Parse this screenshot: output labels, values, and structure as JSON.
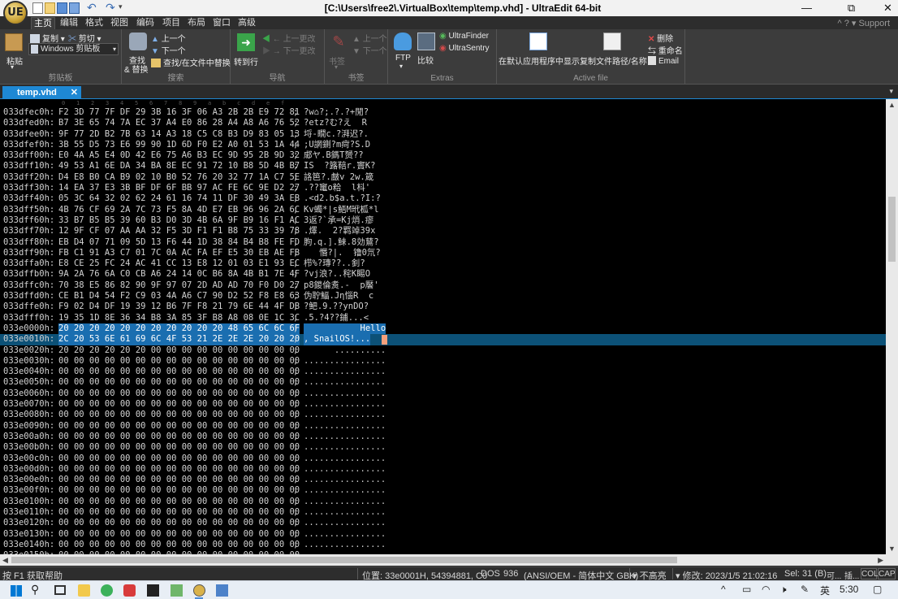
{
  "window": {
    "title": "[C:\\Users\\free2\\.VirtualBox\\temp\\temp.vhd] - UltraEdit 64-bit",
    "logo_text": "UE",
    "controls": [
      "—",
      "⧉",
      "✕"
    ]
  },
  "menu": {
    "tabs": [
      "主页",
      "编辑",
      "格式",
      "视图",
      "编码",
      "项目",
      "布局",
      "窗口",
      "高级"
    ],
    "active": "主页",
    "support": "Support"
  },
  "ribbon": {
    "clipboard": {
      "paste": "粘贴",
      "copy": "复制",
      "cut": "剪切",
      "clipboard_select": "Windows 剪贴板",
      "label": "剪贴板"
    },
    "search": {
      "find_replace_1": "查找",
      "find_replace_2": "& 替换",
      "prev": "上一个",
      "next": "下一个",
      "find_in_files": "查找/在文件中替换",
      "label": "搜索"
    },
    "navigation": {
      "goto": "转到行",
      "prev_change": "上一更改",
      "next_change": "下一更改",
      "label": "导航"
    },
    "bookmarks": {
      "bookmark": "书签",
      "prev": "上一个",
      "next": "下一个",
      "label": "书签"
    },
    "extras": {
      "ftp": "FTP",
      "compare": "比较",
      "ultrafinder": "UltraFinder",
      "ultrasentry": "UltraSentry",
      "label": "Extras"
    },
    "active_file": {
      "show_in_app": "在默认应用程序中显示",
      "copy_path": "复制文件路径/名称",
      "delete": "删除",
      "rename": "重命名",
      "email": "Email",
      "label": "Active file"
    }
  },
  "document": {
    "tab_label": "temp.vhd"
  },
  "ruler": [
    "0",
    "1",
    "2",
    "3",
    "4",
    "5",
    "6",
    "7",
    "8",
    "9",
    "a",
    "b",
    "c",
    "d",
    "e",
    "f"
  ],
  "hex_rows": [
    {
      "addr": "033dfec0h:",
      "hex": "F2 3D 77 7F DF 29 3B 16 3F 06 A3 2B 2B E9 72 81",
      "ascii": "?w⌂?;.?.?+閒?"
    },
    {
      "addr": "033dfed0h:",
      "hex": "B7 3E 65 74 7A EC 37 A4 E0 86 28 A4 A8 A6 76 52",
      "ascii": "?etz?む?え  R"
    },
    {
      "addr": "033dfee0h:",
      "hex": "9F 77 2D B2 7B 63 14 A3 18 C5 C8 B3 D9 83 05 13",
      "ascii": "埒-瞯c.?湃迟?."
    },
    {
      "addr": "033dfef0h:",
      "hex": "3B 55 D5 73 E6 99 90 1D 6D F0 E2 A0 01 53 1A 44",
      "ascii": ";U誷鍘?m疴?S.D"
    },
    {
      "addr": "033dff00h:",
      "hex": "E0 4A A5 E4 0D 42 E6 75 A6 B3 EC 9D 95 2B 9D 32",
      "ascii": "郕ヤ.B鎷T赟??"
    },
    {
      "addr": "033dff10h:",
      "hex": "49 53 A1 6E DA 34 BA 8E EC 91 72 10 B8 5D 4B B7",
      "ascii": "IS  ?簬鞛r.竇K?"
    },
    {
      "addr": "033dff20h:",
      "hex": "D4 E8 B0 CA B9 02 10 B0 52 76 20 32 77 1A C7 5E",
      "ascii": "詻笆?.皻v 2w.箴"
    },
    {
      "addr": "033dff30h:",
      "hex": "14 EA 37 E3 3B BF DF 6F BB 97 AC FE 6C 9E D2 27",
      "ascii": ".??竃o粭  l枓'"
    },
    {
      "addr": "033dff40h:",
      "hex": "05 3C 64 32 02 62 24 61 16 74 11 DF 30 49 3A EB",
      "ascii": ".<d2.b$a.t.?I:?"
    },
    {
      "addr": "033dff50h:",
      "hex": "4B 76 CF 69 2A 7C 73 F5 8A 4D E7 EB 96 96 2A 6C",
      "ascii": "Kv蠋*|s鯃M玳柧*l"
    },
    {
      "addr": "033dff60h:",
      "hex": "33 B7 B5 B5 39 60 B3 D0 3D 4B 6A 9F B9 16 F1 AC",
      "ascii": "3返?`承=Kj焇.瘳"
    },
    {
      "addr": "033dff70h:",
      "hex": "12 9F CF 07 AA AA 32 F5 3D F1 F1 B8 75 33 39 78",
      "ascii": ".燡.  2?羁竨39x"
    },
    {
      "addr": "033dff80h:",
      "hex": "EB D4 07 71 09 5D 13 F6 44 1D 38 84 B4 B8 FE FD",
      "ascii": "朐.q.].鯠.8効鶿?"
    },
    {
      "addr": "033dff90h:",
      "hex": "FB C1 91 A3 C7 01 7C 0A AC FA EF E5 30 EB AE FB",
      "ascii": "   惽?|.  镥0氘?"
    },
    {
      "addr": "033dffa0h:",
      "hex": "E8 CE 25 FC 24 AC 41 CC 13 E8 12 01 03 E1 93 EC",
      "ascii": "栉%?瑼??..釗?"
    },
    {
      "addr": "033dffb0h:",
      "hex": "9A 2A 76 6A C0 CB A6 24 14 0C B6 8A 4B B1 7E 4F",
      "ascii": "?vj浪?..秺K睗O"
    },
    {
      "addr": "033dffc0h:",
      "hex": "70 38 E5 86 82 90 9F 97 07 2D AD AD 70 F0 D0 27",
      "ascii": "p8鍐倫煑.-  p饜'"
    },
    {
      "addr": "033dffd0h:",
      "hex": "CE B1 D4 54 F2 C9 03 4A A6 C7 90 D2 52 F8 E8 63",
      "ascii": "伪聍鰏.Jη惱R  c"
    },
    {
      "addr": "033dffe0h:",
      "hex": "F9 02 D4 DF 19 39 12 B6 7F F8 21 79 6E 44 4F DB",
      "ascii": "?鲃.9.??ynDO?"
    },
    {
      "addr": "033dfff0h:",
      "hex": "19 35 1D 8E 36 34 B8 3A 85 3F B8 A8 08 0E 1C 3C",
      "ascii": ".5.?4??鋪...<"
    },
    {
      "addr": "033e0000h:",
      "hex": "20 20 20 20 20 20 20 20 20 20 20 48 65 6C 6C 6F",
      "ascii": "           Hello",
      "selected": true
    },
    {
      "addr": "033e0010h:",
      "hex": "2C 20 53 6E 61 69 6C 4F 53 21 2E 2E 2E 20 20 20",
      "ascii": ", SnailOS!...",
      "selected": true,
      "current": true
    },
    {
      "addr": "033e0020h:",
      "hex": "20 20 20 20 20 20 00 00 00 00 00 00 00 00 00 00",
      "ascii": "      .........."
    },
    {
      "addr": "033e0030h:",
      "hex": "00 00 00 00 00 00 00 00 00 00 00 00 00 00 00 00",
      "ascii": "................"
    },
    {
      "addr": "033e0040h:",
      "hex": "00 00 00 00 00 00 00 00 00 00 00 00 00 00 00 00",
      "ascii": "................"
    },
    {
      "addr": "033e0050h:",
      "hex": "00 00 00 00 00 00 00 00 00 00 00 00 00 00 00 00",
      "ascii": "................"
    },
    {
      "addr": "033e0060h:",
      "hex": "00 00 00 00 00 00 00 00 00 00 00 00 00 00 00 00",
      "ascii": "................"
    },
    {
      "addr": "033e0070h:",
      "hex": "00 00 00 00 00 00 00 00 00 00 00 00 00 00 00 00",
      "ascii": "................"
    },
    {
      "addr": "033e0080h:",
      "hex": "00 00 00 00 00 00 00 00 00 00 00 00 00 00 00 00",
      "ascii": "................"
    },
    {
      "addr": "033e0090h:",
      "hex": "00 00 00 00 00 00 00 00 00 00 00 00 00 00 00 00",
      "ascii": "................"
    },
    {
      "addr": "033e00a0h:",
      "hex": "00 00 00 00 00 00 00 00 00 00 00 00 00 00 00 00",
      "ascii": "................"
    },
    {
      "addr": "033e00b0h:",
      "hex": "00 00 00 00 00 00 00 00 00 00 00 00 00 00 00 00",
      "ascii": "................"
    },
    {
      "addr": "033e00c0h:",
      "hex": "00 00 00 00 00 00 00 00 00 00 00 00 00 00 00 00",
      "ascii": "................"
    },
    {
      "addr": "033e00d0h:",
      "hex": "00 00 00 00 00 00 00 00 00 00 00 00 00 00 00 00",
      "ascii": "................"
    },
    {
      "addr": "033e00e0h:",
      "hex": "00 00 00 00 00 00 00 00 00 00 00 00 00 00 00 00",
      "ascii": "................"
    },
    {
      "addr": "033e00f0h:",
      "hex": "00 00 00 00 00 00 00 00 00 00 00 00 00 00 00 00",
      "ascii": "................"
    },
    {
      "addr": "033e0100h:",
      "hex": "00 00 00 00 00 00 00 00 00 00 00 00 00 00 00 00",
      "ascii": "................"
    },
    {
      "addr": "033e0110h:",
      "hex": "00 00 00 00 00 00 00 00 00 00 00 00 00 00 00 00",
      "ascii": "................"
    },
    {
      "addr": "033e0120h:",
      "hex": "00 00 00 00 00 00 00 00 00 00 00 00 00 00 00 00",
      "ascii": "................"
    },
    {
      "addr": "033e0130h:",
      "hex": "00 00 00 00 00 00 00 00 00 00 00 00 00 00 00 00",
      "ascii": "................"
    },
    {
      "addr": "033e0140h:",
      "hex": "00 00 00 00 00 00 00 00 00 00 00 00 00 00 00 00",
      "ascii": "................"
    },
    {
      "addr": "033e0150h:",
      "hex": "00 00 00 00 00 00 00 00 00 00 00 00 00 00 00 00",
      "ascii": "................"
    }
  ],
  "status": {
    "help": "按 F1 获取帮助",
    "position": "位置: 33e0001H, 54394881, C0",
    "line_ending": "DOS",
    "codepage": "936",
    "encoding": "(ANSI/OEM - 简体中文 GBK)",
    "highlight": "不高亮",
    "modified": "修改: 2023/1/5 21:02:16",
    "selection": "Sel: 31 (B)",
    "writable": "可...",
    "insert": "插...",
    "col": "COL",
    "cap": "CAP"
  },
  "taskbar": {
    "time": "5:30",
    "ime": "英",
    "tray_up": "^"
  },
  "colors": {
    "accent": "#1e88d4",
    "selection": "#1a6eb0",
    "current_line": "#0c5177",
    "caret": "#f4a07c"
  }
}
